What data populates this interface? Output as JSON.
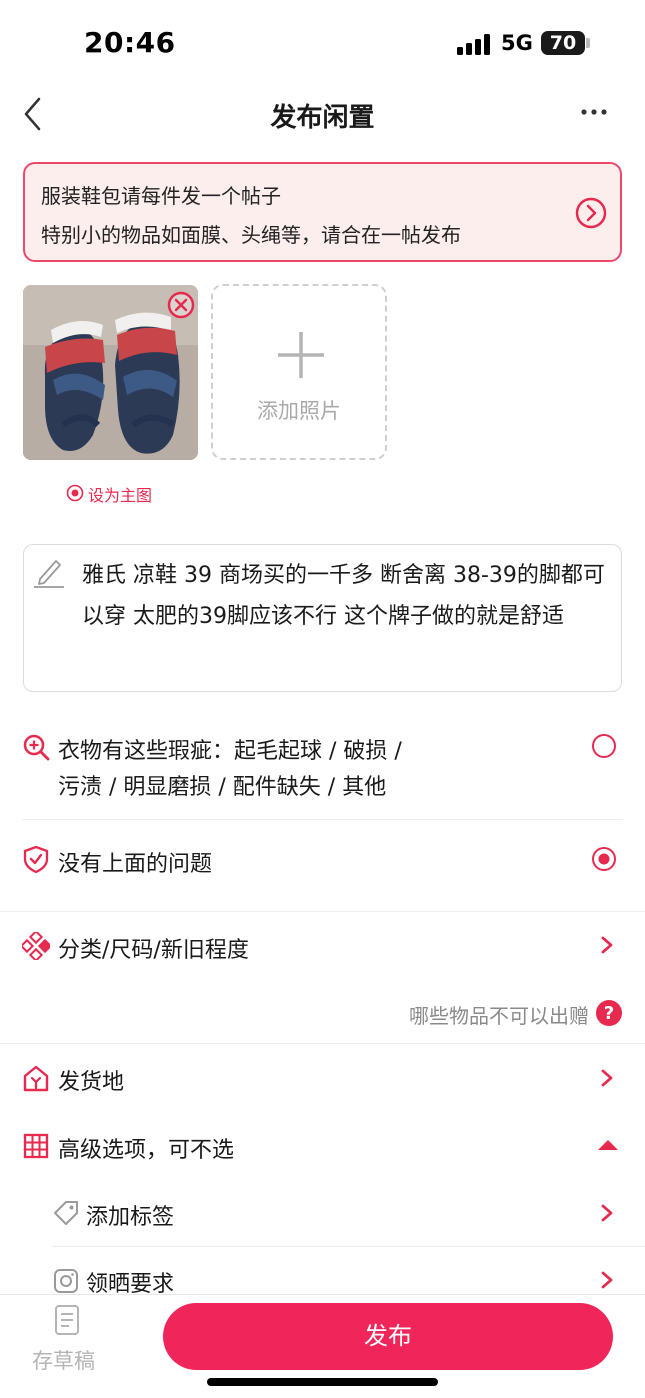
{
  "status_bar": {
    "time": "20:46",
    "network": "5G",
    "battery": "70"
  },
  "nav": {
    "title": "发布闲置"
  },
  "notice": {
    "line1": "服装鞋包请每件发一个帖子",
    "line2": "特别小的物品如面膜、头绳等，请合在一帖发布"
  },
  "photos": {
    "add_label": "添加照片",
    "set_main_label": "设为主图"
  },
  "description": {
    "text": "雅氏 凉鞋 39 商场买的一千多 断舍离 38-39的脚都可以穿 太肥的39脚应该不行 这个牌子做的就是舒适"
  },
  "condition": {
    "flaw_line1": "衣物有这些瑕疵：起毛起球 / 破损 /",
    "flaw_line2": "污渍 / 明显磨损 / 配件缺失 / 其他",
    "no_flaw": "没有上面的问题",
    "selected": "no_flaw"
  },
  "rows": {
    "category": "分类/尺码/新旧程度",
    "forbidden_note": "哪些物品不可以出赠",
    "ship_from": "发货地",
    "advanced": "高级选项，可不选",
    "add_tags": "添加标签",
    "claim_req": "领晒要求"
  },
  "bottom": {
    "draft": "存草稿",
    "publish": "发布"
  },
  "colors": {
    "accent": "#f0265a",
    "notice_bg": "#fdeeee",
    "notice_border": "#f0476d"
  }
}
